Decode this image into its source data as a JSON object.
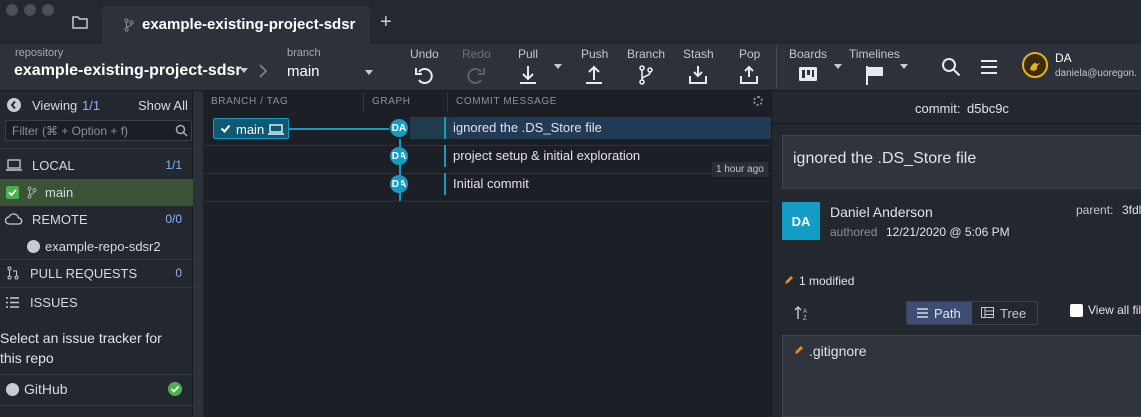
{
  "titlebar": {
    "tab_title": "example-existing-project-sdsr",
    "add_tab": "+"
  },
  "toolbar": {
    "repo_label": "repository",
    "repo_name": "example-existing-project-sdsr",
    "branch_label": "branch",
    "branch_name": "main",
    "undo": "Undo",
    "redo": "Redo",
    "pull": "Pull",
    "push": "Push",
    "branch": "Branch",
    "stash": "Stash",
    "pop": "Pop",
    "boards": "Boards",
    "timelines": "Timelines",
    "user_initials": "DA",
    "user_email": "daniela@uoregon."
  },
  "sidebar": {
    "viewing": "Viewing",
    "viewing_count": "1/1",
    "show_all": "Show All",
    "filter_placeholder": "Filter (⌘ + Option + f)",
    "local": "LOCAL",
    "local_count": "1/1",
    "local_branch": "main",
    "remote": "REMOTE",
    "remote_count": "0/0",
    "remote_repo": "example-repo-sdsr2",
    "pull_requests": "PULL REQUESTS",
    "pr_count": "0",
    "issues": "ISSUES",
    "issues_msg": "Select an issue tracker for this repo",
    "github": "GitHub"
  },
  "graph": {
    "col_branch": "BRANCH / TAG",
    "col_graph": "GRAPH",
    "col_message": "COMMIT MESSAGE",
    "branch_badge": "main",
    "time_label": "1 hour ago",
    "commits": [
      {
        "initials": "DA",
        "message": "ignored the .DS_Store file"
      },
      {
        "initials": "DA",
        "message": "project setup & initial exploration"
      },
      {
        "initials": "DA",
        "message": "Initial commit"
      }
    ]
  },
  "detail": {
    "commit_label": "commit:",
    "commit_sha": "d5bc9c",
    "message": "ignored the .DS_Store file",
    "author_initials": "DA",
    "author": "Daniel Anderson",
    "authored_label": "authored",
    "authored_date": "12/21/2020 @ 5:06 PM",
    "parent_label": "parent:",
    "parent_sha": "3fdl",
    "modified": "1 modified",
    "path_btn": "Path",
    "tree_btn": "Tree",
    "view_all": "View all fil",
    "file": ".gitignore"
  },
  "colors": {
    "accent": "#159cc4",
    "selected_branch": "#3a5235",
    "link": "#8ab4f8",
    "green_check": "#4caf50"
  }
}
